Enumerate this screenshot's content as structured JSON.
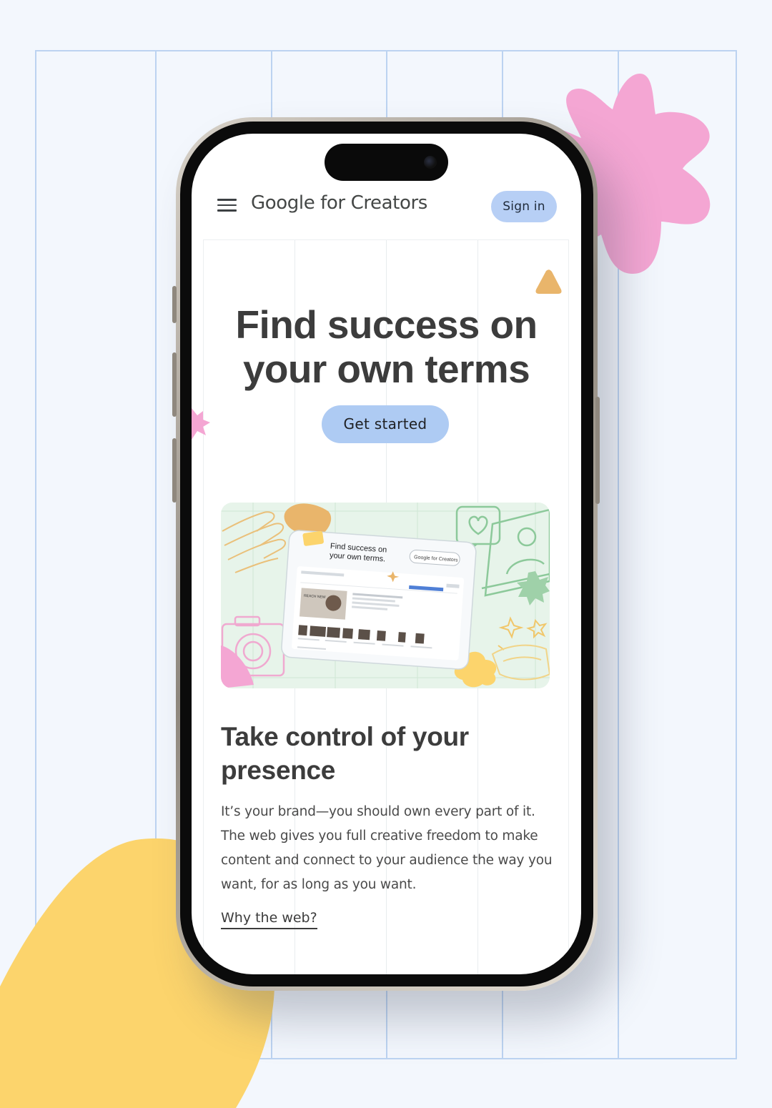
{
  "header": {
    "brand": "Google for Creators",
    "signin_label": "Sign in"
  },
  "hero": {
    "title_line1": "Find success on",
    "title_line2": "your own terms",
    "cta_label": "Get started"
  },
  "hero_image": {
    "card_title_line1": "Find success on",
    "card_title_line2": "your own terms.",
    "card_button": "Google for Creators",
    "card_preview_text": "REACH NEW"
  },
  "section": {
    "title": "Take control of your presence",
    "body": "It’s your brand—you should own every part of it. The web gives you full creative freedom to make content and connect to your audience the way you want, for as long as you want.",
    "link_label": "Why the web?"
  },
  "colors": {
    "accent_blue": "#aecbf3",
    "pink": "#f4a6d3",
    "yellow": "#fcd46c",
    "orange": "#e9b56b",
    "green_bg": "#e7f4ea"
  },
  "icons": [
    "menu-icon",
    "camera-icon",
    "heart-chat-icon",
    "profile-icon",
    "hand-icon",
    "sparkle-icon"
  ]
}
